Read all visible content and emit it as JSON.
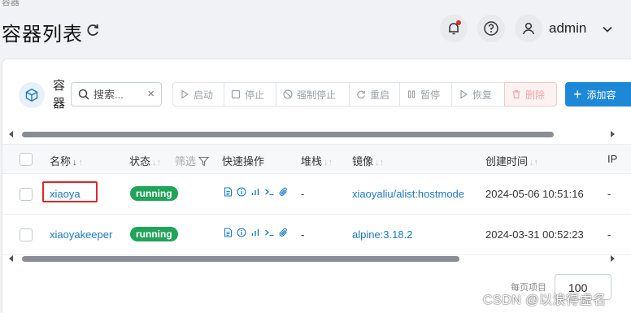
{
  "breadcrumb": "容器",
  "header": {
    "title": "容器列表",
    "username": "admin",
    "icons": {
      "refresh": "refresh-icon",
      "notify": "bell-icon",
      "help": "help-icon",
      "user": "user-icon"
    }
  },
  "section": {
    "title": "容器"
  },
  "search": {
    "placeholder": "搜索...",
    "value": ""
  },
  "toolbar": {
    "start": "启动",
    "stop": "停止",
    "kill": "强制停止",
    "restart": "重启",
    "pause": "暂停",
    "resume": "恢复",
    "delete": "删除",
    "add": "添加容"
  },
  "table": {
    "headers": {
      "name": "名称",
      "state": "状态",
      "filter": "筛选",
      "quick": "快速操作",
      "stack": "堆栈",
      "image": "镜像",
      "created": "创建时间",
      "ip": "IP"
    },
    "rows": [
      {
        "name": "xiaoya",
        "state": "running",
        "stack": "-",
        "image": "xiaoyaliu/alist:hostmode",
        "created": "2024-05-06 10:51:16",
        "ip": "-"
      },
      {
        "name": "xiaoyakeeper",
        "state": "running",
        "stack": "-",
        "image": "alpine:3.18.2",
        "created": "2024-03-31 00:52:23",
        "ip": "-"
      }
    ],
    "quick_icons": [
      "logs-icon",
      "inspect-icon",
      "stats-icon",
      "console-icon",
      "attach-icon"
    ]
  },
  "pager": {
    "label": "每页项目",
    "value": "100"
  },
  "watermark": "CSDN @以浪得虚名",
  "colors": {
    "accent": "#1e88d8",
    "running": "#21a35a",
    "highlight": "#e0262b",
    "danger": "#f1a7a7"
  }
}
